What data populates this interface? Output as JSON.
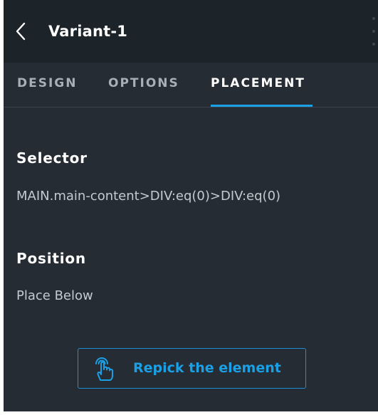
{
  "header": {
    "title": "Variant-1",
    "back_icon": "chevron-left-icon",
    "menu_icon": "kebab-menu-icon"
  },
  "tabs": [
    {
      "label": "DESIGN",
      "active": false
    },
    {
      "label": "OPTIONS",
      "active": false
    },
    {
      "label": "PLACEMENT",
      "active": true
    }
  ],
  "selector": {
    "label": "Selector",
    "value": "MAIN.main-content>DIV:eq(0)>DIV:eq(0)"
  },
  "position": {
    "label": "Position",
    "value": "Place Below"
  },
  "repick_button": {
    "label": "Repick the element",
    "icon": "pointer-hand-icon"
  },
  "colors": {
    "panel_bg": "#252c33",
    "header_bg": "#1c2329",
    "accent": "#1ba0e6",
    "text_primary": "#ffffff",
    "text_secondary": "#c3cad1"
  }
}
